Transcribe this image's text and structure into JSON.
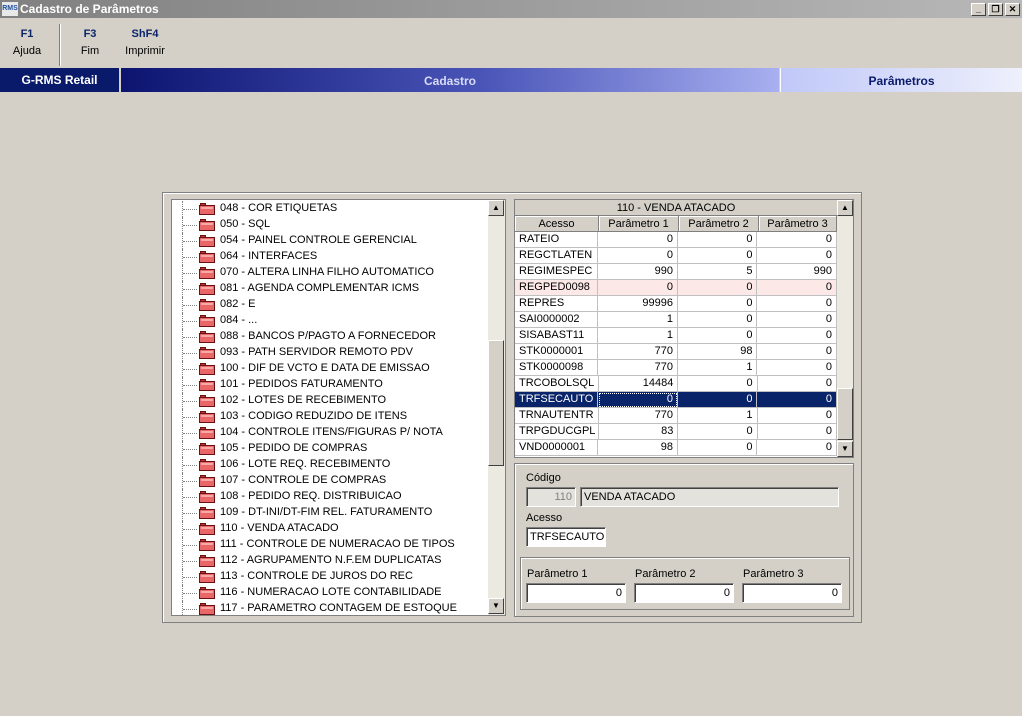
{
  "window": {
    "icon_text": "RMS",
    "title": "Cadastro de Parâmetros",
    "buttons": [
      "_",
      "❐",
      "✕"
    ]
  },
  "toolbar": {
    "keys": [
      {
        "key": "F1",
        "label": "Ajuda"
      },
      {
        "key": "F3",
        "label": "Fim"
      },
      {
        "key": "ShF4",
        "label": "Imprimir"
      }
    ]
  },
  "banner": {
    "brand": "G-RMS Retail",
    "section": "Cadastro",
    "page": "Parâmetros"
  },
  "tree": {
    "items": [
      "048 - COR ETIQUETAS",
      "050 - SQL",
      "054 - PAINEL CONTROLE GERENCIAL",
      "064 - INTERFACES",
      "070 - ALTERA LINHA FILHO AUTOMATICO",
      "081 - AGENDA COMPLEMENTAR ICMS",
      "082 - E",
      "084 - ...",
      "088 - BANCOS P/PAGTO A FORNECEDOR",
      "093 - PATH SERVIDOR REMOTO PDV",
      "100 - DIF DE VCTO E DATA DE EMISSAO",
      "101 - PEDIDOS FATURAMENTO",
      "102 - LOTES DE RECEBIMENTO",
      "103 - CODIGO REDUZIDO DE ITENS",
      "104 - CONTROLE ITENS/FIGURAS P/ NOTA",
      "105 - PEDIDO DE COMPRAS",
      "106 - LOTE REQ. RECEBIMENTO",
      "107 - CONTROLE DE COMPRAS",
      "108 - PEDIDO REQ. DISTRIBUICAO",
      "109 - DT-INI/DT-FIM REL. FATURAMENTO",
      "110 - VENDA ATACADO",
      "111 - CONTROLE DE NUMERACAO DE TIPOS",
      "112 - AGRUPAMENTO N.F.EM DUPLICATAS",
      "113 - CONTROLE DE JUROS DO REC",
      "116 - NUMERACAO LOTE CONTABILIDADE",
      "117 - PARAMETRO CONTAGEM DE ESTOQUE"
    ]
  },
  "grid": {
    "title": "110 - VENDA ATACADO",
    "columns": [
      "Acesso",
      "Parâmetro 1",
      "Parâmetro 2",
      "Parâmetro 3"
    ],
    "rows": [
      [
        "RATEIO",
        "0",
        "0",
        "0"
      ],
      [
        "REGCTLATEN",
        "0",
        "0",
        "0"
      ],
      [
        "REGIMESPEC",
        "990",
        "5",
        "990"
      ],
      [
        "REGPED0098",
        "0",
        "0",
        "0"
      ],
      [
        "REPRES",
        "99996",
        "0",
        "0"
      ],
      [
        "SAI0000002",
        "1",
        "0",
        "0"
      ],
      [
        "SISABAST11",
        "1",
        "0",
        "0"
      ],
      [
        "STK0000001",
        "770",
        "98",
        "0"
      ],
      [
        "STK0000098",
        "770",
        "1",
        "0"
      ],
      [
        "TRCOBOLSQL",
        "14484",
        "0",
        "0"
      ],
      [
        "TRFSECAUTO",
        "0",
        "0",
        "0"
      ],
      [
        "TRNAUTENTR",
        "770",
        "1",
        "0"
      ],
      [
        "TRPGDUCGPL",
        "83",
        "0",
        "0"
      ],
      [
        "VND0000001",
        "98",
        "0",
        "0"
      ]
    ],
    "selected_row": 10,
    "highlight_row": 3
  },
  "form": {
    "codigo_label": "Código",
    "codigo_value": "110",
    "descricao_value": "VENDA ATACADO",
    "acesso_label": "Acesso",
    "acesso_value": "TRFSECAUTO",
    "param1_label": "Parâmetro 1",
    "param1_value": "0",
    "param2_label": "Parâmetro 2",
    "param2_value": "0",
    "param3_label": "Parâmetro 3",
    "param3_value": "0"
  }
}
